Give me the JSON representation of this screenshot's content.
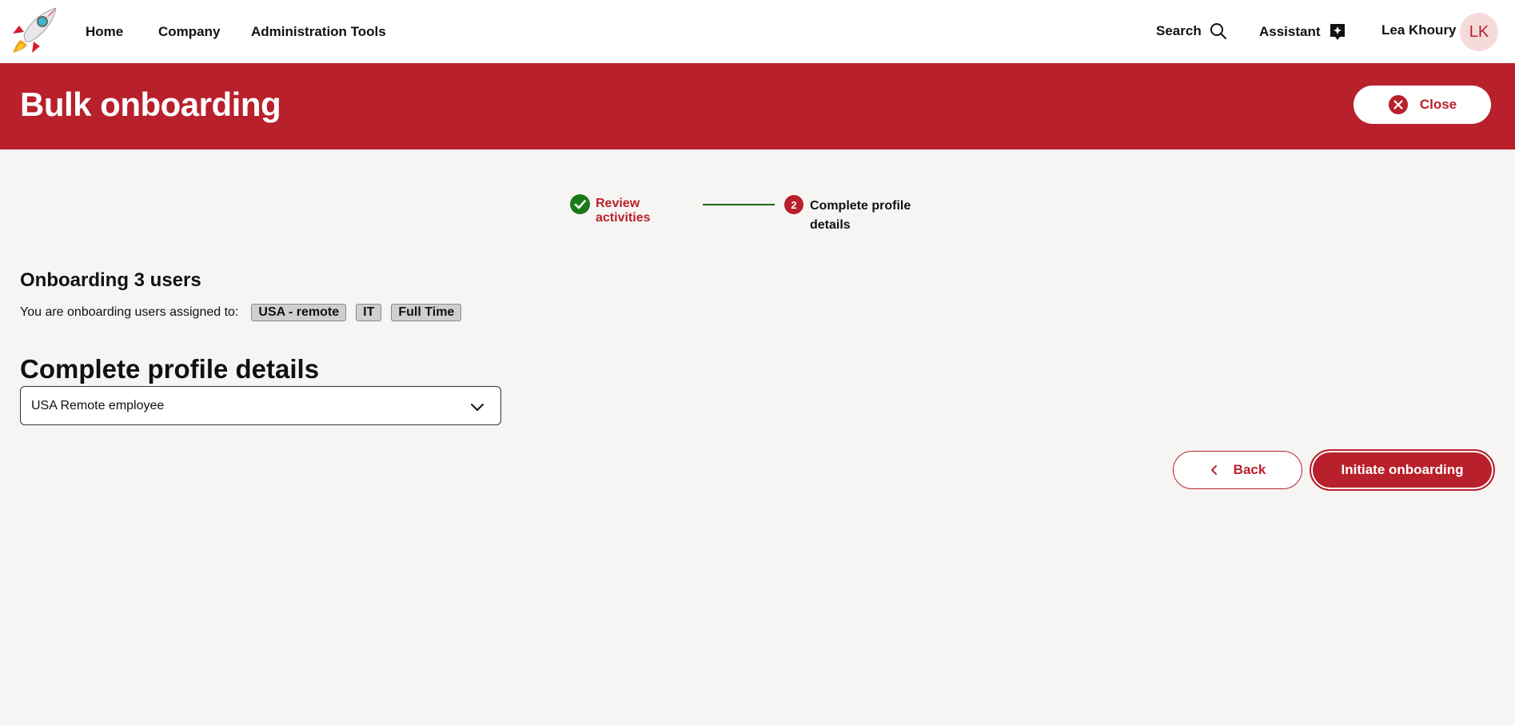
{
  "nav": {
    "links": [
      "Home",
      "Company",
      "Administration Tools"
    ],
    "search_label": "Search",
    "assistant_label": "Assistant",
    "user_name": "Lea Khoury",
    "user_initials": "LK"
  },
  "banner": {
    "title": "Bulk onboarding",
    "close_label": "Close"
  },
  "stepper": {
    "step1_label": "Review activities",
    "step1_state": "complete",
    "step2_number": "2",
    "step2_label": "Complete profile details",
    "step2_state": "current"
  },
  "summary": {
    "heading": "Onboarding 3 users",
    "assigned_text": "You are onboarding users assigned to:",
    "tags": [
      "USA - remote",
      "IT",
      "Full Time"
    ]
  },
  "profile": {
    "heading": "Complete profile details",
    "selected_option": "USA Remote employee"
  },
  "actions": {
    "back_label": "Back",
    "primary_label": "Initiate onboarding"
  },
  "colors": {
    "brand": "#b8202b",
    "success": "#1a7a1a",
    "background": "#f6f5f3"
  }
}
